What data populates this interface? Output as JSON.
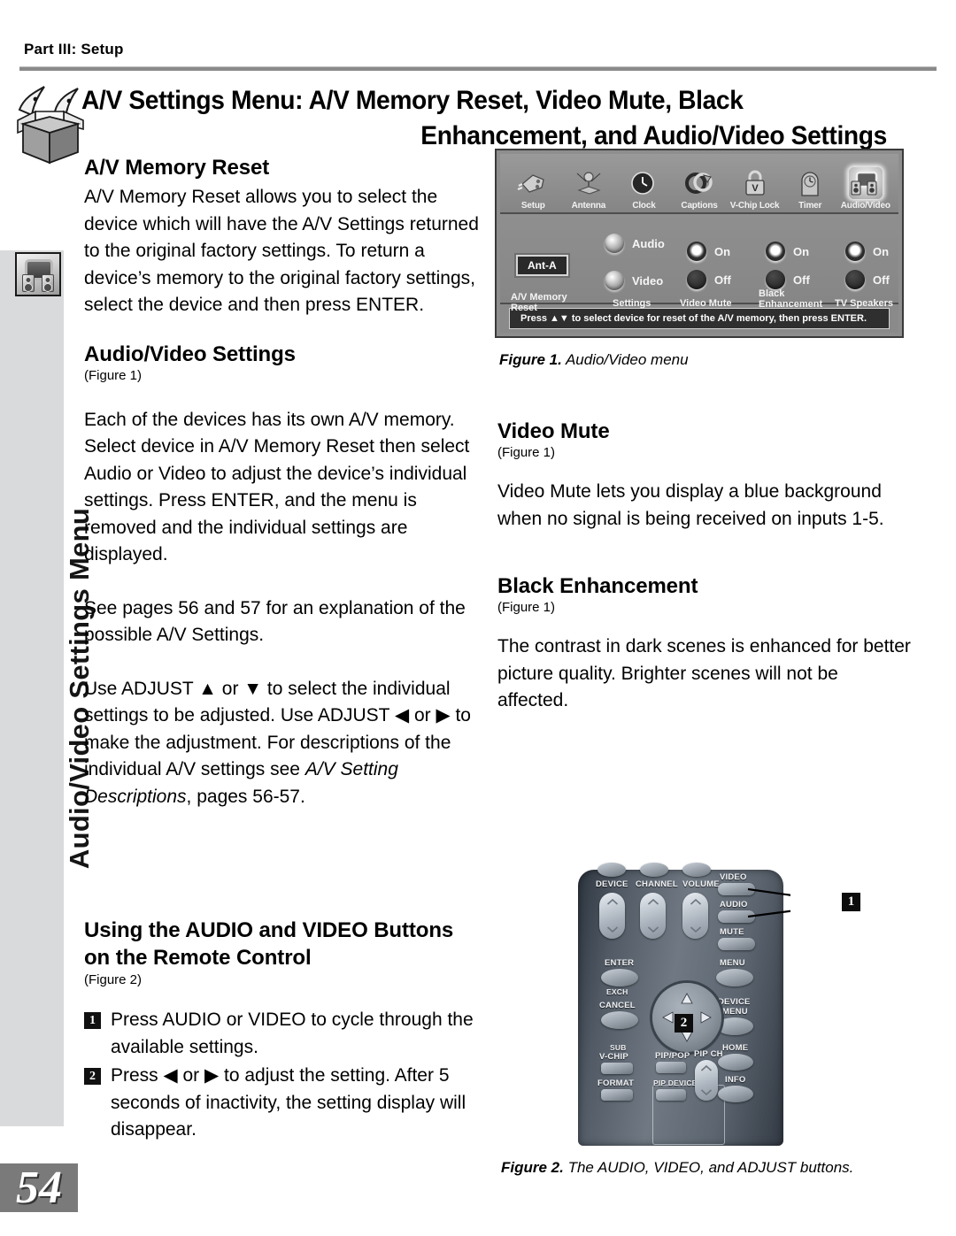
{
  "header": {
    "part_label": "Part III: Setup",
    "title_line1": "A/V Settings Menu: A/V Memory Reset, Video Mute, Black",
    "title_line2": "Enhancement, and Audio/Video Settings",
    "box_icon": "open-box-icon"
  },
  "sidebar": {
    "label": "Audio/Video Settings Menu",
    "icon": "audio-video-icon"
  },
  "page_number": "54",
  "left_column": {
    "section1": {
      "heading": "A/V Memory Reset",
      "body": "A/V Memory Reset allows you to select the device which will have the A/V Settings returned to the original factory settings.  To return a device’s memory to the original factory settings, select the device and then press ENTER."
    },
    "section2": {
      "heading": "Audio/Video Settings",
      "figure_ref": "(Figure 1)",
      "para1": "Each of the devices has its own A/V memory.  Select device in A/V Memory Reset then select Audio or Video to adjust the device’s individual settings.  Press ENTER, and the menu is removed and the individual settings are displayed.",
      "para2": "See pages 56 and 57 for an explanation of the possible A/V Settings.",
      "para3_a": "Use ADJUST ",
      "para3_up": "▲",
      "para3_b": " or ",
      "para3_down": "▼",
      "para3_c": " to select the individual settings to be adjusted.  Use ADJUST ",
      "para3_left": "◀",
      "para3_d": " or ",
      "para3_right": "▶",
      "para3_e": " to make the adjustment.  For descriptions of the individual A/V settings see ",
      "para3_italic": "A/V Setting Descriptions",
      "para3_f": ", pages 56-57."
    },
    "section3": {
      "heading_line1": "Using the AUDIO and VIDEO Buttons",
      "heading_line2": "on the Remote Control",
      "figure_ref": "(Figure 2)",
      "steps": [
        {
          "num": "1",
          "text": "Press AUDIO or VIDEO to cycle through the available settings."
        },
        {
          "num": "2",
          "text_a": "Press ",
          "left": "◀",
          "text_b": " or ",
          "right": "▶",
          "text_c": " to adjust the setting.  After 5 seconds of inactivity, the setting display will disappear."
        }
      ]
    }
  },
  "right_column": {
    "section1": {
      "heading": "Video Mute",
      "figure_ref": "(Figure 1)",
      "body": "Video Mute lets you display a blue background when no signal is being received on inputs 1-5."
    },
    "section2": {
      "heading": "Black Enhancement",
      "figure_ref": "(Figure 1)",
      "body": "The contrast in dark scenes is enhanced for better picture quality.  Brighter scenes will not be affected."
    }
  },
  "figure1": {
    "caption_bold": "Figure 1.",
    "caption_rest": " Audio/Video menu",
    "menu_icons": [
      {
        "label": "Setup",
        "icon": "plug-icon",
        "selected": false
      },
      {
        "label": "Antenna",
        "icon": "antenna-icon",
        "selected": false
      },
      {
        "label": "Clock",
        "icon": "clock-icon",
        "selected": false
      },
      {
        "label": "Captions",
        "icon": "captions-icon",
        "selected": false
      },
      {
        "label": "V-Chip Lock",
        "icon": "padlock-icon",
        "selected": false
      },
      {
        "label": "Timer",
        "icon": "timer-icon",
        "selected": false
      },
      {
        "label": "Audio/Video",
        "icon": "audio-video-icon",
        "selected": true
      }
    ],
    "av_memory": {
      "value": "Ant-A",
      "caption_line1": "A/V Memory",
      "caption_line2": "Reset"
    },
    "settings": {
      "caption": "Settings",
      "options": [
        {
          "label": "Audio",
          "state": "knob"
        },
        {
          "label": "Video",
          "state": "knob"
        }
      ]
    },
    "video_mute": {
      "caption": "Video Mute",
      "options": [
        {
          "label": "On",
          "selected": true
        },
        {
          "label": "Off",
          "selected": false
        }
      ]
    },
    "black_enhancement": {
      "caption_line1": "Black",
      "caption_line2": "Enhancement",
      "options": [
        {
          "label": "On",
          "selected": true
        },
        {
          "label": "Off",
          "selected": false
        }
      ]
    },
    "tv_speakers": {
      "caption": "TV Speakers",
      "options": [
        {
          "label": "On",
          "selected": true
        },
        {
          "label": "Off",
          "selected": false
        }
      ]
    },
    "hint": "Press ▲▼ to select device for reset of the A/V memory, then press ENTER."
  },
  "figure2": {
    "caption_bold": "Figure 2.",
    "caption_rest": "  The AUDIO, VIDEO, and ADJUST buttons.",
    "labels": {
      "device": "DEVICE",
      "channel": "CHANNEL",
      "volume": "VOLUME",
      "video": "VIDEO",
      "audio": "AUDIO",
      "mute": "MUTE",
      "enter": "ENTER",
      "exch": "EXCH",
      "menu": "MENU",
      "cancel": "CANCEL",
      "sub": "SUB",
      "vchip": "V-CHIP",
      "format": "FORMAT",
      "device_menu_line1": "DEVICE",
      "device_menu_line2": "MENU",
      "home": "HOME",
      "info": "INFO",
      "pip_pop": "PIP/POP",
      "pip_ch": "PIP CH",
      "pip_device": "PIP DEVICE"
    },
    "callouts": [
      {
        "num": "1"
      },
      {
        "num": "2"
      }
    ]
  }
}
